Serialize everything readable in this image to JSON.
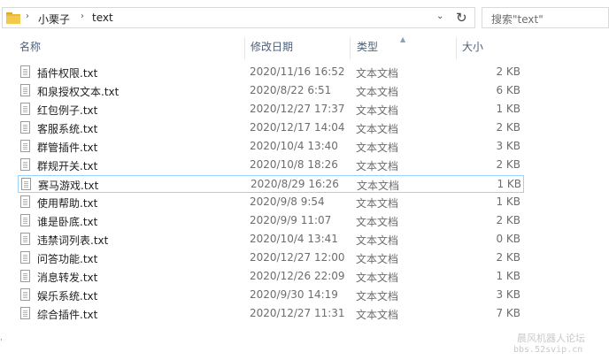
{
  "address": {
    "crumbs": [
      "小栗子",
      "text"
    ],
    "separator": "›"
  },
  "search": {
    "placeholder": "搜索\"text\""
  },
  "columns": {
    "name": "名称",
    "date": "修改日期",
    "type": "类型",
    "size": "大小"
  },
  "files": [
    {
      "name": "插件权限.txt",
      "date": "2020/11/16 16:52",
      "type": "文本文档",
      "size": "2 KB"
    },
    {
      "name": "和泉授权文本.txt",
      "date": "2020/8/22 6:51",
      "type": "文本文档",
      "size": "6 KB"
    },
    {
      "name": "红包例子.txt",
      "date": "2020/12/27 17:37",
      "type": "文本文档",
      "size": "1 KB"
    },
    {
      "name": "客服系统.txt",
      "date": "2020/12/17 14:04",
      "type": "文本文档",
      "size": "2 KB"
    },
    {
      "name": "群管插件.txt",
      "date": "2020/10/4 13:40",
      "type": "文本文档",
      "size": "3 KB"
    },
    {
      "name": "群规开关.txt",
      "date": "2020/10/8 18:26",
      "type": "文本文档",
      "size": "2 KB"
    },
    {
      "name": "赛马游戏.txt",
      "date": "2020/8/29 16:26",
      "type": "文本文档",
      "size": "1 KB"
    },
    {
      "name": "使用帮助.txt",
      "date": "2020/9/8 9:54",
      "type": "文本文档",
      "size": "1 KB"
    },
    {
      "name": "谁是卧底.txt",
      "date": "2020/9/9 11:07",
      "type": "文本文档",
      "size": "2 KB"
    },
    {
      "name": "违禁词列表.txt",
      "date": "2020/10/4 13:41",
      "type": "文本文档",
      "size": "0 KB"
    },
    {
      "name": "问答功能.txt",
      "date": "2020/12/27 12:00",
      "type": "文本文档",
      "size": "2 KB"
    },
    {
      "name": "消息转发.txt",
      "date": "2020/12/26 22:09",
      "type": "文本文档",
      "size": "1 KB"
    },
    {
      "name": "娱乐系统.txt",
      "date": "2020/9/30 14:19",
      "type": "文本文档",
      "size": "3 KB"
    },
    {
      "name": "综合插件.txt",
      "date": "2020/12/27 11:31",
      "type": "文本文档",
      "size": "7 KB"
    }
  ],
  "selected_index": 6,
  "watermark": {
    "line1": "晨风机器人论坛",
    "line2": "bbs.52svip.cn"
  },
  "colors": {
    "selection_border": "#99d1ff",
    "header_text": "#4c607a",
    "folder_yellow": "#e8b93a"
  },
  "icons": {
    "folder": "folder-icon",
    "file": "text-file-icon",
    "refresh": "refresh-icon",
    "dropdown": "chevron-down-icon"
  }
}
